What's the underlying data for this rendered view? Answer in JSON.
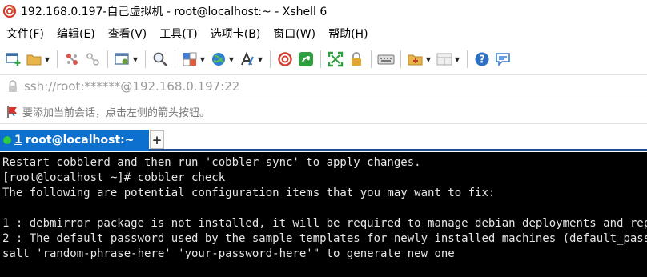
{
  "window": {
    "title": "192.168.0.197-自己虚拟机 - root@localhost:~ - Xshell 6"
  },
  "menu": {
    "items": [
      {
        "label": "文件(F)"
      },
      {
        "label": "编辑(E)"
      },
      {
        "label": "查看(V)"
      },
      {
        "label": "工具(T)"
      },
      {
        "label": "选项卡(B)"
      },
      {
        "label": "窗口(W)"
      },
      {
        "label": "帮助(H)"
      }
    ]
  },
  "toolbar": {
    "icons": [
      "new-session-icon",
      "open-folder-icon",
      "reconnect-icon",
      "disconnect-icon",
      "properties-icon",
      "find-icon",
      "color-scheme-icon",
      "globe-icon",
      "font-icon",
      "xshell-icon",
      "xftp-icon",
      "fullscreen-icon",
      "lock-icon",
      "keyboard-icon",
      "new-tab-folder-icon",
      "layout-icon",
      "help-icon",
      "chat-icon"
    ]
  },
  "address": {
    "value": "ssh://root:******@192.168.0.197:22"
  },
  "hint": {
    "text": "要添加当前会话，点击左侧的箭头按钮。"
  },
  "tabs": [
    {
      "number": "1",
      "label": "root@localhost:~",
      "status_color": "#2ecc40"
    }
  ],
  "terminal": {
    "lines": [
      "Restart cobblerd and then run 'cobbler sync' to apply changes.",
      "[root@localhost ~]# cobbler check",
      "The following are potential configuration items that you may want to fix:",
      "",
      "1 : debmirror package is not installed, it will be required to manage debian deployments and repositories",
      "2 : The default password used by the sample templates for newly installed machines (default_password_crypted",
      "salt 'random-phrase-here' 'your-password-here'\" to generate new one"
    ]
  },
  "colors": {
    "tab_active": "#0d6fce",
    "terminal_bg": "#000000",
    "terminal_fg": "#e6e6e6"
  }
}
